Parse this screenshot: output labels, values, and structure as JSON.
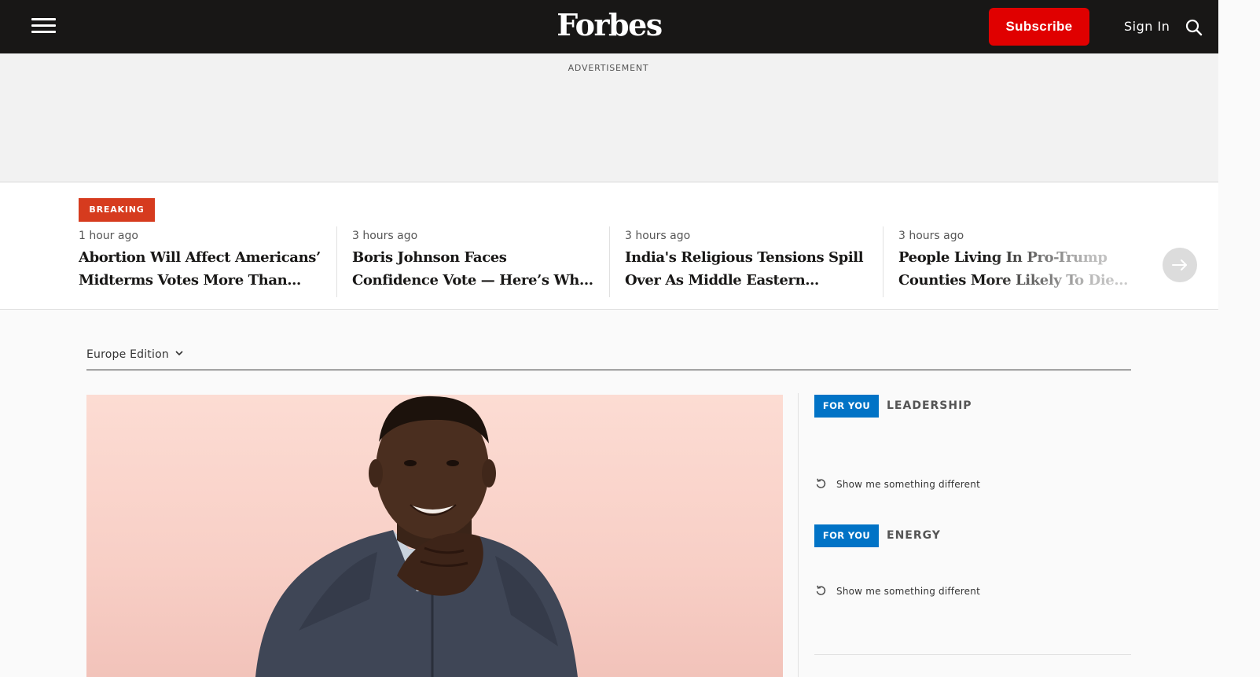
{
  "header": {
    "logo": "Forbes",
    "subscribe_label": "Subscribe",
    "signin_label": "Sign In",
    "icons": [
      "hamburger-menu-icon",
      "search-icon"
    ],
    "colors": {
      "bar": "#181716",
      "subscribe": "#e00000"
    }
  },
  "ad": {
    "label": "ADVERTISEMENT"
  },
  "breaking": {
    "badge": "BREAKING",
    "badge_color": "#d63b1e",
    "stories": [
      {
        "time": "1 hour ago",
        "title": "Abortion Will Affect Americans’ Midterms Votes More Than Ever, Poll Finds"
      },
      {
        "time": "3 hours ago",
        "title": "Boris Johnson Faces Confidence Vote — Here’s What You Need To Know"
      },
      {
        "time": "3 hours ago",
        "title": "India's Religious Tensions Spill Over As Middle Eastern Countries Condemn Remarks"
      },
      {
        "time": "3 hours ago",
        "title": "People Living In Pro-Trump Counties More Likely To Die From Covid"
      }
    ],
    "next_icon": "arrow-right-icon"
  },
  "main": {
    "edition_label": "Europe Edition",
    "for_you": [
      {
        "badge": "FOR YOU",
        "topic": "LEADERSHIP",
        "refresh_label": "Show me something different"
      },
      {
        "badge": "FOR YOU",
        "topic": "ENERGY",
        "refresh_label": "Show me something different"
      }
    ],
    "badge_color": "#0173c6"
  }
}
